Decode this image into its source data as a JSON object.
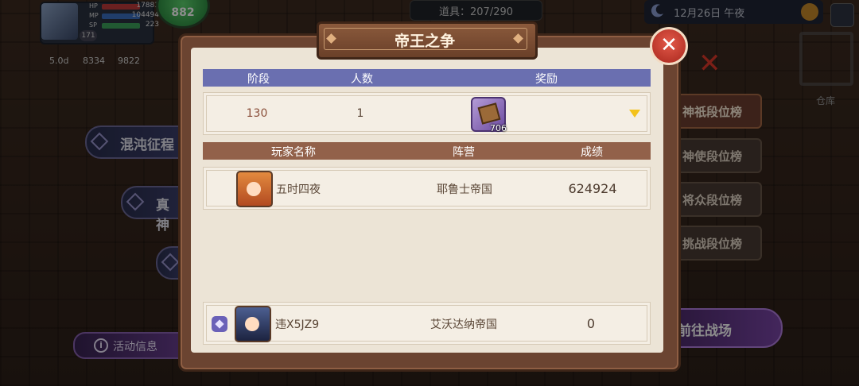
{
  "hud": {
    "hp_label": "HP",
    "hp_value": "17881",
    "mp_label": "MP",
    "mp_value": "104494",
    "sp_label": "SP",
    "sp_value": "223",
    "level": "171",
    "orb_value": "882",
    "res1": "5.0d",
    "res2": "8334",
    "res3": "9822",
    "items_label": "道具：207/290",
    "date": "12月26日 午夜",
    "warehouse": "仓库"
  },
  "left_menu": {
    "chaos": "混沌征程",
    "truth": "真神",
    "activity_info": "活动信息",
    "info_glyph": "i"
  },
  "right_tabs": [
    "神祇段位榜",
    "神使段位榜",
    "将众段位榜",
    "挑战段位榜"
  ],
  "go_battle": "前往战场",
  "modal": {
    "title": "帝王之争",
    "close_glyph": "✕",
    "tier_headers": {
      "stage": "阶段",
      "count": "人数",
      "reward": "奖励"
    },
    "tier_row": {
      "stage": "130",
      "count": "1",
      "reward_count": "706"
    },
    "player_headers": {
      "name": "玩家名称",
      "faction": "阵营",
      "score": "成绩"
    },
    "players": [
      {
        "name": "五时四夜",
        "faction": "耶鲁士帝国",
        "score": "624924"
      }
    ],
    "self": {
      "name": "违X5JZ9",
      "faction": "艾沃达纳帝国",
      "score": "0"
    }
  },
  "colors": {
    "header_blue": "#6a6fb0",
    "header_brown": "#92614a",
    "close_red": "#c9372a",
    "arrow_gold": "#f3c21b"
  },
  "icons": [
    "close-icon",
    "dropdown-arrow-icon",
    "treasure-chest-icon",
    "rank-badge-icon",
    "moon-icon",
    "globe-icon",
    "info-icon"
  ]
}
